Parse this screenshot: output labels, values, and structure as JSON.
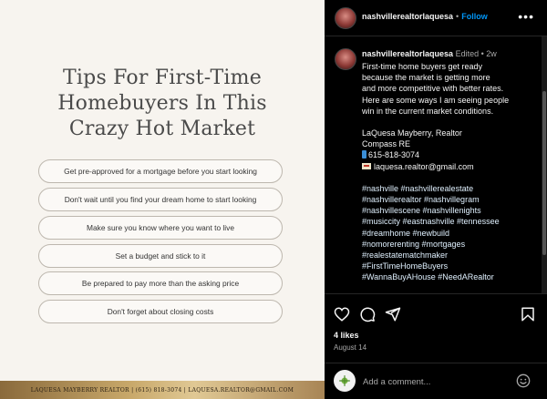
{
  "post_image": {
    "title_lines": [
      "Tips For First-Time",
      "Homebuyers In This",
      "Crazy Hot Market"
    ],
    "tips": [
      "Get pre-approved for a mortgage before you start looking",
      "Don't wait until you find your dream home to start looking",
      "Make sure you know where you want to live",
      "Set a budget and stick to it",
      "Be prepared to pay more than the asking price",
      "Don't forget about closing costs"
    ],
    "footer_text": "LAQUESA MAYBERRY REALTOR | (615) 818-3074 | LAQUESA.REALTOR@GMAIL.COM"
  },
  "header": {
    "username": "nashvillerealtorlaquesa",
    "separator": "•",
    "follow_label": "Follow",
    "more_icon": "more-options-icon"
  },
  "caption": {
    "username": "nashvillerealtorlaquesa",
    "edited": "Edited",
    "separator": "•",
    "age": "2w",
    "intro_lines": [
      "First-time home buyers get ready",
      "because the market is getting more",
      "and more competitive with better rates.",
      "Here are some ways I am seeing people",
      "win in the current market conditions."
    ],
    "contact_name": "LaQuesa Mayberry, Realtor",
    "contact_company": "Compass RE",
    "contact_phone": "615-818-3074",
    "contact_email": "laquesa.realtor@gmail.com",
    "hashtag_lines": [
      "#nashville #nashvillerealestate",
      "#nashvillerealtor #nashvillegram",
      "#nashvillescene #nashvillenights",
      "#musiccity #eastnashville #tennessee",
      "#dreamhome #newbuild",
      "#nomorerenting #mortgages",
      "#realestatematchmaker",
      "#FirstTimeHomeBuyers",
      "#WannaBuyAHouse #NeedARealtor"
    ]
  },
  "actions": {
    "likes": "4 likes",
    "date": "August 14"
  },
  "comment": {
    "placeholder": "Add a comment..."
  },
  "colors": {
    "accent": "#0095f6",
    "panel_bg": "#000000",
    "image_bg": "#f7f4ef"
  }
}
